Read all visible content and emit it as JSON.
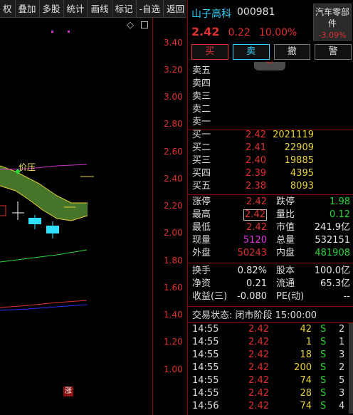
{
  "toolbar": {
    "items": [
      "权",
      "叠加",
      "多股",
      "统计",
      "画线",
      "标记",
      "-自选",
      "返回"
    ]
  },
  "chart": {
    "price_ticks": [
      "3.40",
      "3.20",
      "3.00",
      "2.80",
      "2.60",
      "2.40",
      "2.20",
      "2.00",
      "1.80",
      "1.60",
      "1.40",
      "1.20",
      "1.00"
    ],
    "annotation": "价压",
    "rise_marker": "涨",
    "icons": [
      "diamond-icon",
      "square-icon"
    ],
    "colors": {
      "axis": "#8b0000",
      "band_fill": "#4a7a2a",
      "band_upper": "#e6d23a",
      "band_lower": "#e6d23a",
      "ma_magenta": "#d030d0",
      "ma_green": "#27d43a",
      "ma_blue": "#3030ff",
      "ma_red": "#e03030",
      "down_candle": "#2fe0ff",
      "up_candle": "#e03030"
    }
  },
  "quote": {
    "name": "山子高科",
    "code": "000981",
    "sector": {
      "name": "汽车零部件",
      "change": "-3.09%"
    },
    "price": "2.42",
    "change": "0.22",
    "change_pct": "10.00%",
    "buttons": {
      "buy": "买",
      "sell": "卖",
      "cancel": "撤",
      "alert": "警"
    },
    "collapse_icon": "chevron-down-icon"
  },
  "orderbook": {
    "asks": [
      {
        "label": "卖五",
        "price": "",
        "volume": ""
      },
      {
        "label": "卖四",
        "price": "",
        "volume": ""
      },
      {
        "label": "卖三",
        "price": "",
        "volume": ""
      },
      {
        "label": "卖二",
        "price": "",
        "volume": ""
      },
      {
        "label": "卖一",
        "price": "",
        "volume": ""
      }
    ],
    "bids": [
      {
        "label": "买一",
        "price": "2.42",
        "volume": "2021119"
      },
      {
        "label": "买二",
        "price": "2.41",
        "volume": "22909"
      },
      {
        "label": "买三",
        "price": "2.40",
        "volume": "19885"
      },
      {
        "label": "买四",
        "price": "2.39",
        "volume": "4395"
      },
      {
        "label": "买五",
        "price": "2.38",
        "volume": "8093"
      }
    ]
  },
  "stats": {
    "limit_up_label": "涨停",
    "limit_up": "2.42",
    "limit_down_label": "跌停",
    "limit_down": "1.98",
    "high_label": "最高",
    "high": "2.42",
    "vol_ratio_label": "量比",
    "vol_ratio": "0.12",
    "low_label": "最低",
    "low": "2.42",
    "mkt_cap_label": "市值",
    "mkt_cap": "241.9亿",
    "cur_vol_label": "现量",
    "cur_vol": "5120",
    "total_vol_label": "总量",
    "total_vol": "532151",
    "outer_label": "外盘",
    "outer": "50243",
    "inner_label": "内盘",
    "inner": "481908",
    "turnover_label": "换手",
    "turnover": "0.82%",
    "share_cap_label": "股本",
    "share_cap": "100.0亿",
    "nav_label": "净资",
    "nav": "0.21",
    "float_label": "流通",
    "float": "65.3亿",
    "eps_label": "收益(三)",
    "eps": "-0.080",
    "pe_label": "PE(动)",
    "pe": "--"
  },
  "status": {
    "label": "交易状态:",
    "value": "闭市阶段 15:00:00"
  },
  "ticks": [
    {
      "time": "14:55",
      "price": "2.42",
      "volume": "42",
      "side": "S",
      "n": "2"
    },
    {
      "time": "14:55",
      "price": "2.42",
      "volume": "1",
      "side": "S",
      "n": "1"
    },
    {
      "time": "14:55",
      "price": "2.42",
      "volume": "18",
      "side": "S",
      "n": "3"
    },
    {
      "time": "14:55",
      "price": "2.42",
      "volume": "200",
      "side": "S",
      "n": "2"
    },
    {
      "time": "14:55",
      "price": "2.42",
      "volume": "74",
      "side": "S",
      "n": "5"
    },
    {
      "time": "14:55",
      "price": "2.42",
      "volume": "28",
      "side": "S",
      "n": "3"
    },
    {
      "time": "14:56",
      "price": "2.42",
      "volume": "74",
      "side": "S",
      "n": "4"
    }
  ]
}
